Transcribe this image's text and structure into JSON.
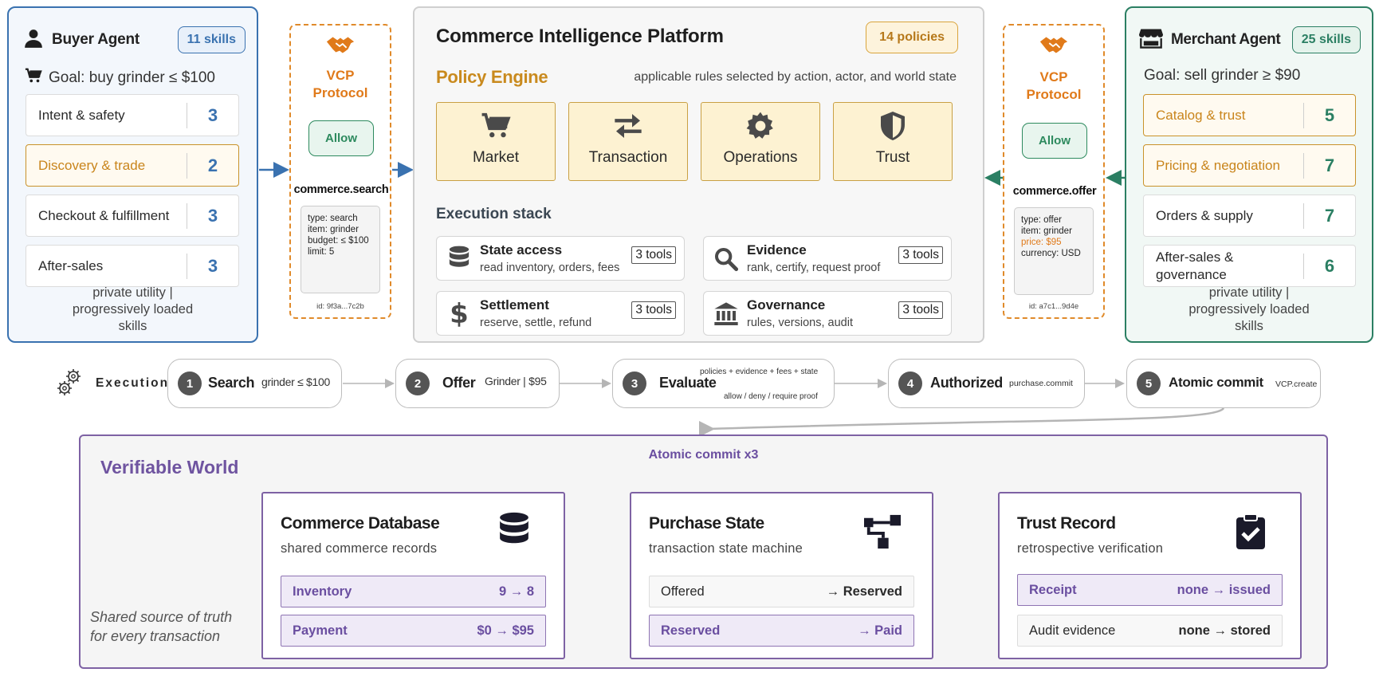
{
  "buyer": {
    "title": "Buyer Agent",
    "skills_badge": "11 skills",
    "goal": "Goal: buy grinder ≤ $100",
    "skills": [
      {
        "name": "Intent & safety",
        "count": "3",
        "highlight": false
      },
      {
        "name": "Discovery & trade",
        "count": "2",
        "highlight": true
      },
      {
        "name": "Checkout & fulfillment",
        "count": "3",
        "highlight": false
      },
      {
        "name": "After-sales",
        "count": "3",
        "highlight": false
      }
    ],
    "footer": "private utility | progressively loaded skills"
  },
  "merchant": {
    "title": "Merchant Agent",
    "skills_badge": "25 skills",
    "goal": "Goal: sell grinder ≥ $90",
    "skills": [
      {
        "name": "Catalog & trust",
        "count": "5",
        "highlight": true
      },
      {
        "name": "Pricing & negotiation",
        "count": "7",
        "highlight": true
      },
      {
        "name": "Orders & supply",
        "count": "7",
        "highlight": false
      },
      {
        "name": "After-sales & governance",
        "count": "6",
        "highlight": false
      }
    ],
    "footer": "private utility | progressively loaded skills"
  },
  "vcp_left": {
    "title_line1": "VCP",
    "title_line2": "Protocol",
    "allow_label": "Allow",
    "command": "commerce.search",
    "payload": [
      "type: search",
      "item: grinder",
      "budget: ≤ $100",
      "limit: 5"
    ],
    "id": "id: 9f3a...7c2b"
  },
  "vcp_right": {
    "title_line1": "VCP",
    "title_line2": "Protocol",
    "allow_label": "Allow",
    "command": "commerce.offer",
    "payload": [
      "type: offer",
      "item: grinder",
      "price: $95",
      "currency: USD"
    ],
    "id": "id: a7c1...9d4e"
  },
  "platform": {
    "title": "Commerce Intelligence Platform",
    "policies_badge": "14 policies",
    "policy_engine_title": "Policy Engine",
    "policy_engine_subtitle": "applicable rules selected by action, actor, and world state",
    "policy_cards": [
      {
        "label": "Market",
        "icon": "cart-icon"
      },
      {
        "label": "Transaction",
        "icon": "swap-icon"
      },
      {
        "label": "Operations",
        "icon": "gear-icon"
      },
      {
        "label": "Trust",
        "icon": "shield-icon"
      }
    ],
    "execution_stack_title": "Execution stack",
    "tools": [
      {
        "name": "State access",
        "desc": "read inventory, orders, fees",
        "badge": "3 tools",
        "icon": "database-icon"
      },
      {
        "name": "Evidence",
        "desc": "rank, certify, request proof",
        "badge": "3 tools",
        "icon": "magnifier-icon"
      },
      {
        "name": "Settlement",
        "desc": "reserve, settle, refund",
        "badge": "3 tools",
        "icon": "dollar-icon"
      },
      {
        "name": "Governance",
        "desc": "rules, versions, audit",
        "badge": "3 tools",
        "icon": "institution-icon"
      }
    ]
  },
  "execution": {
    "label": "Execution",
    "steps": [
      {
        "num": "1",
        "name": "Search",
        "detail": "grinder ≤ $100"
      },
      {
        "num": "2",
        "name": "Offer",
        "detail": "Grinder | $95"
      },
      {
        "num": "3",
        "name": "Evaluate",
        "detail_top": "policies + evidence + fees + state",
        "detail_bottom": "allow / deny / require proof"
      },
      {
        "num": "4",
        "name": "Authorized",
        "detail": "purchase.commit"
      },
      {
        "num": "5",
        "name": "Atomic commit",
        "detail": "VCP.create"
      }
    ]
  },
  "world": {
    "title": "Verifiable World",
    "atomic_label": "Atomic commit x3",
    "footer_line1": "Shared source of truth",
    "footer_line2": "for every transaction",
    "cards": [
      {
        "title": "Commerce Database",
        "subtitle": "shared commerce records",
        "icon": "database-icon",
        "rows": [
          {
            "label": "Inventory",
            "value": "9 → 8",
            "style": "purple"
          },
          {
            "label": "Payment",
            "value": "$0 → $95",
            "style": "purple"
          }
        ]
      },
      {
        "title": "Purchase State",
        "subtitle": "transaction state machine",
        "icon": "state-machine-icon",
        "rows": [
          {
            "label": "Offered",
            "value": "→ Reserved",
            "style": "plain"
          },
          {
            "label": "Reserved",
            "value": "→ Paid",
            "style": "purple"
          }
        ]
      },
      {
        "title": "Trust Record",
        "subtitle": "retrospective verification",
        "icon": "clipboard-check-icon",
        "rows": [
          {
            "label": "Receipt",
            "value": "none → issued",
            "style": "purple"
          },
          {
            "label": "Audit evidence",
            "value": "none → stored",
            "style": "plain"
          }
        ]
      }
    ]
  },
  "colors": {
    "buyer_accent": "#3a72b0",
    "merchant_accent": "#2b7f63",
    "policy_accent": "#c98a1e",
    "protocol_accent": "#e08a2a",
    "world_accent": "#7e62a4"
  }
}
